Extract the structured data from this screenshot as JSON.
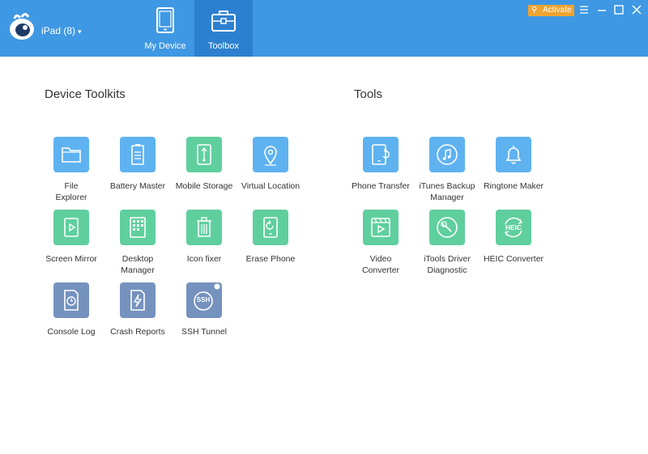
{
  "header": {
    "device_label": "iPad (8)",
    "device_caret": "▾",
    "activate_label": "Activate",
    "tabs": [
      {
        "label": "My Device",
        "icon": "tablet-icon",
        "active": false
      },
      {
        "label": "Toolbox",
        "icon": "toolbox-icon",
        "active": true
      }
    ],
    "window_controls": [
      "menu-icon",
      "minimize-icon",
      "maximize-icon",
      "close-icon"
    ]
  },
  "colors": {
    "header": "#3f98e3",
    "active_tab": "#2d80cf",
    "activate": "#f0a430",
    "blue_tool": "#5eb2f0",
    "green_tool": "#5fcf9e",
    "slate_tool": "#7592bf"
  },
  "device_toolkits": {
    "title": "Device Toolkits",
    "items": [
      {
        "label": "File Explorer",
        "icon": "folder-icon"
      },
      {
        "label": "Battery Master",
        "icon": "battery-icon"
      },
      {
        "label": "Mobile Storage",
        "icon": "usb-icon"
      },
      {
        "label": "Virtual Location",
        "icon": "location-pin-icon"
      },
      {
        "label": "Screen Mirror",
        "icon": "screen-mirror-icon"
      },
      {
        "label": "Desktop Manager",
        "icon": "desktop-grid-icon"
      },
      {
        "label": "Icon fixer",
        "icon": "trash-icon"
      },
      {
        "label": "Erase Phone",
        "icon": "erase-phone-icon"
      },
      {
        "label": "Console Log",
        "icon": "clock-file-icon"
      },
      {
        "label": "Crash Reports",
        "icon": "lightning-file-icon"
      },
      {
        "label": "SSH Tunnel",
        "icon": "ssh-icon",
        "badge": "SSH"
      }
    ]
  },
  "tools": {
    "title": "Tools",
    "items": [
      {
        "label": "Phone Transfer",
        "icon": "phone-transfer-icon"
      },
      {
        "label": "iTunes Backup Manager",
        "icon": "music-backup-icon"
      },
      {
        "label": "Ringtone Maker",
        "icon": "bell-icon"
      },
      {
        "label": "Video Converter",
        "icon": "video-icon"
      },
      {
        "label": "iTools Driver Diagnostic",
        "icon": "wrench-icon"
      },
      {
        "label": "HEIC Converter",
        "icon": "heic-icon",
        "badge": "HEIC"
      }
    ]
  }
}
